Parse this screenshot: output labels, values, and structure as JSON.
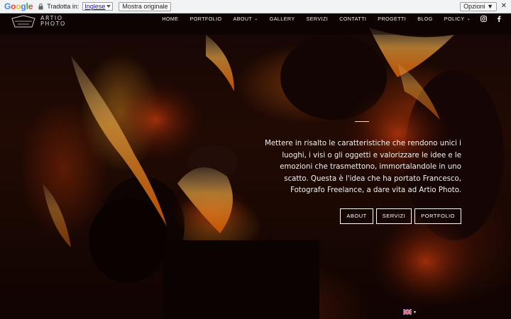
{
  "translate_bar": {
    "logo_letters": [
      "G",
      "o",
      "o",
      "g",
      "l",
      "e"
    ],
    "translated_label": "Tradotta in:",
    "language": "Inglese",
    "show_original": "Mostra originale",
    "options": "Opzioni ▼",
    "close": "✕"
  },
  "site": {
    "logo_line1": "ARTIO",
    "logo_line2": "PHOTO"
  },
  "nav": {
    "items": [
      "HOME",
      "PORTFOLIO",
      "ABOUT",
      "GALLERY",
      "SERVIZI",
      "CONTATTI",
      "PROGETTI",
      "BLOG",
      "POLICY"
    ],
    "dropdown_chevron": "⌄"
  },
  "hero": {
    "text": "Mettere in risalto le caratteristiche che rendono unici i luoghi, i visi o gli oggetti e valorizzare le idee e le emozioni che trasmettono, immortalandole in uno scatto. Questa è l'idea che ha portato Francesco, Fotografo Freelance, a dare vita ad Artio Photo.",
    "buttons": [
      "ABOUT",
      "SERVIZI",
      "PORTFOLIO"
    ]
  },
  "language_switcher": {
    "caret": "▾"
  },
  "colors": {
    "fire_bright": "#ffb347",
    "fire_mid": "#e0521a",
    "ember": "#7a1a08"
  }
}
